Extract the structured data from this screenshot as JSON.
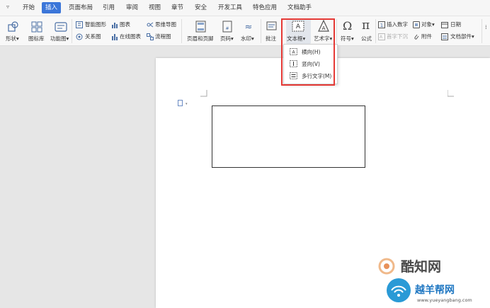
{
  "menubar": {
    "tabs": [
      "开始",
      "插入",
      "页面布局",
      "引用",
      "审阅",
      "视图",
      "章节",
      "安全",
      "开发工具",
      "特色应用",
      "文档助手"
    ],
    "active_tab": "插入"
  },
  "ribbon": {
    "shape": "形状",
    "icon_lib": "图标库",
    "func_chart": "功能图",
    "smart_shape": "智能图形",
    "chart": "图表",
    "mind_map": "思维导图",
    "relation": "关系图",
    "online_chart": "在线图表",
    "flowchart": "流程图",
    "header_footer": "页眉和页脚",
    "page_num": "页码",
    "watermark": "水印",
    "comment": "批注",
    "textbox": "文本框",
    "wordart": "艺术字",
    "symbol": "符号",
    "formula": "公式",
    "insert_number": "插入数字",
    "drop_cap": "首字下沉",
    "object": "对象",
    "attachment": "附件",
    "date": "日期",
    "doc_parts": "文档部件"
  },
  "textbox_menu": {
    "items": [
      "横向(H)",
      "竖向(V)",
      "多行文字(M)"
    ]
  },
  "watermark_site": {
    "brand1": "酷知网",
    "brand2": "越羊帮网",
    "url": "www.yueyangbang.com"
  },
  "colors": {
    "accent": "#3b76d9",
    "highlight": "#e53935"
  }
}
